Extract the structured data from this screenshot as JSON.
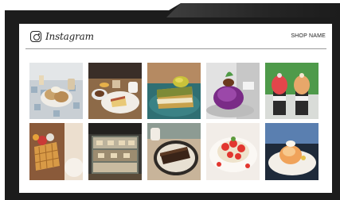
{
  "header": {
    "brand": "Instagram",
    "shop_name": "SHOP NAME"
  },
  "feed": {
    "posts": [
      {
        "subject": "cream-puffs-on-tile-table"
      },
      {
        "subject": "cake-slices-and-coffee"
      },
      {
        "subject": "matcha-cake-slice"
      },
      {
        "subject": "purple-mont-blanc-cake"
      },
      {
        "subject": "strawberry-cupcakes"
      },
      {
        "subject": "waffle-with-fruit"
      },
      {
        "subject": "pastry-display-case"
      },
      {
        "subject": "chocolate-cake-slice"
      },
      {
        "subject": "strawberry-tart"
      },
      {
        "subject": "peach-dessert-plate"
      }
    ]
  },
  "colors": {
    "frame": "#1c1c1c",
    "screen": "#ffffff",
    "divider": "#9a9a9a"
  }
}
